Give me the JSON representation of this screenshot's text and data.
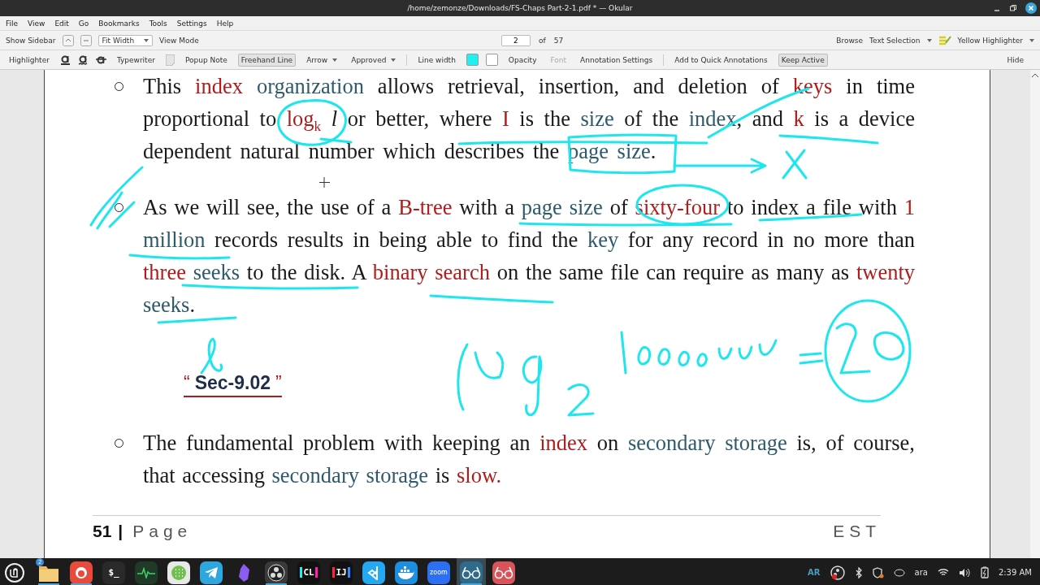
{
  "window": {
    "title": "/home/zemonze/Downloads/FS-Chaps Part-2-1.pdf * — Okular"
  },
  "menu": [
    "File",
    "View",
    "Edit",
    "Go",
    "Bookmarks",
    "Tools",
    "Settings",
    "Help"
  ],
  "toolbar": {
    "show_sidebar": "Show Sidebar",
    "zoom": "Fit Width",
    "view_mode": "View Mode",
    "page": "2",
    "of": "of",
    "total": "57",
    "browse": "Browse",
    "text_selection": "Text Selection",
    "highlighter": "Yellow Highlighter"
  },
  "annotation_bar": [
    {
      "kind": "label",
      "label": "Highlighter"
    },
    {
      "kind": "underline"
    },
    {
      "kind": "squiggle"
    },
    {
      "kind": "strike"
    },
    {
      "kind": "label",
      "label": "Typewriter"
    },
    {
      "kind": "note"
    },
    {
      "kind": "label",
      "label": "Popup Note"
    },
    {
      "kind": "toggle",
      "label": "Freehand Line",
      "selected": true
    },
    {
      "kind": "dropdown",
      "label": "Arrow"
    },
    {
      "kind": "dropdown",
      "label": "Approved"
    },
    {
      "kind": "separator"
    },
    {
      "kind": "label",
      "label": "Line width"
    },
    {
      "kind": "swatch",
      "color": "#22f0f0"
    },
    {
      "kind": "swatch",
      "color": "#ffffff"
    },
    {
      "kind": "label",
      "label": "Opacity"
    },
    {
      "kind": "label",
      "label": "Font",
      "disabled": true
    },
    {
      "kind": "label",
      "label": "Annotation Settings"
    },
    {
      "kind": "separator"
    },
    {
      "kind": "label",
      "label": "Add to Quick Annotations"
    },
    {
      "kind": "toggle",
      "label": "Keep Active",
      "selected": true
    },
    {
      "kind": "spacer"
    },
    {
      "kind": "label",
      "label": "Hide"
    }
  ],
  "document": {
    "paragraphs": [
      {
        "bullet": true,
        "segments": [
          {
            "text": "This ",
            "color": "#1a1a1a"
          },
          {
            "text": "index ",
            "color": "#b01c1c"
          },
          {
            "text": "organization",
            "color": "#2e5a6b"
          },
          {
            "text": " allows retrieval, insertion, and deletion of ",
            "color": "#1a1a1a"
          },
          {
            "text": "keys",
            "color": "#b01c1c"
          },
          {
            "text": " in time proportional to ",
            "color": "#1a1a1a"
          },
          {
            "text": "log$_{k}$",
            "color": "#b01c1c"
          },
          {
            "text": " *l* or better, where ",
            "color": "#1a1a1a"
          },
          {
            "text": "I",
            "color": "#b01c1c"
          },
          {
            "text": " is the ",
            "color": "#1a1a1a"
          },
          {
            "text": "size",
            "color": "#2e5a6b"
          },
          {
            "text": " of the ",
            "color": "#1a1a1a"
          },
          {
            "text": "index",
            "color": "#2e5a6b"
          },
          {
            "text": ", and ",
            "color": "#1a1a1a"
          },
          {
            "text": "k",
            "color": "#b01c1c"
          },
          {
            "text": " is a device dependent natural number which describes the ",
            "color": "#1a1a1a"
          },
          {
            "text": "page size",
            "color": "#2e5a6b"
          },
          {
            "text": ".",
            "color": "#1a1a1a"
          }
        ]
      },
      {
        "bullet": true,
        "segments": [
          {
            "text": "As we will see, the use of a ",
            "color": "#1a1a1a"
          },
          {
            "text": "B-tree",
            "color": "#b01c1c"
          },
          {
            "text": " with a ",
            "color": "#1a1a1a"
          },
          {
            "text": "page size",
            "color": "#2e5a6b"
          },
          {
            "text": " of ",
            "color": "#1a1a1a"
          },
          {
            "text": "sixty-four",
            "color": "#b01c1c"
          },
          {
            "text": " to index a file with ",
            "color": "#1a1a1a"
          },
          {
            "text": "1 ",
            "color": "#b01c1c"
          },
          {
            "text": "million",
            "color": "#2e5a6b"
          },
          {
            "text": " records results in being able to find the ",
            "color": "#1a1a1a"
          },
          {
            "text": "key",
            "color": "#2e5a6b"
          },
          {
            "text": " for any record in no more than ",
            "color": "#1a1a1a"
          },
          {
            "text": "three ",
            "color": "#b01c1c"
          },
          {
            "text": "seeks",
            "color": "#2e5a6b"
          },
          {
            "text": " to the disk. A ",
            "color": "#1a1a1a"
          },
          {
            "text": "binary search",
            "color": "#b01c1c"
          },
          {
            "text": " on the same file can require as many as ",
            "color": "#1a1a1a"
          },
          {
            "text": "twenty ",
            "color": "#b01c1c"
          },
          {
            "text": "seeks",
            "color": "#2e5a6b"
          },
          {
            "text": ".",
            "color": "#1a1a1a"
          }
        ]
      }
    ],
    "heading": [
      {
        "text": "“",
        "color": "#b01c1c"
      },
      {
        "text": "Sec-9.02",
        "color": "#1f2d4a"
      },
      {
        "text": "”",
        "color": "#b01c1c"
      }
    ],
    "paragraphs_after": [
      {
        "bullet": true,
        "segments": [
          {
            "text": "The fundamental problem with keeping an ",
            "color": "#1a1a1a"
          },
          {
            "text": "index",
            "color": "#b01c1c"
          },
          {
            "text": " on ",
            "color": "#1a1a1a"
          },
          {
            "text": "secondary storage",
            "color": "#2e5a6b"
          },
          {
            "text": " is, of course, that accessing ",
            "color": "#1a1a1a"
          },
          {
            "text": "secondary storage",
            "color": "#2e5a6b"
          },
          {
            "text": " is ",
            "color": "#1a1a1a"
          },
          {
            "text": "slow.",
            "color": "#b01c1c"
          }
        ]
      }
    ],
    "footer": {
      "page_number": "51",
      "separator": "|",
      "page_label": "Page",
      "right": "EST"
    }
  },
  "taskbar": {
    "apps": [
      {
        "kind": "folder",
        "badge": "2",
        "running": true,
        "selected": false
      },
      {
        "kind": "firefox",
        "running": true,
        "selected": false
      },
      {
        "kind": "terminal",
        "label": "$_",
        "running": false,
        "selected": false
      },
      {
        "kind": "monitor",
        "running": false,
        "selected": false
      },
      {
        "kind": "grid",
        "running": false,
        "selected": false
      },
      {
        "kind": "telegram",
        "running": false,
        "selected": false
      },
      {
        "kind": "crystal",
        "running": false,
        "selected": false
      },
      {
        "kind": "obs",
        "running": true,
        "selected": false
      },
      {
        "kind": "clion",
        "label": "CL",
        "running": false,
        "selected": false
      },
      {
        "kind": "intellij",
        "label": "IJ",
        "running": false,
        "selected": false
      },
      {
        "kind": "vscode",
        "running": false,
        "selected": false
      },
      {
        "kind": "docker",
        "running": false,
        "selected": false
      },
      {
        "kind": "zoom",
        "label": "zoom",
        "running": false,
        "selected": false
      },
      {
        "kind": "glasses",
        "running": true,
        "selected": true
      },
      {
        "kind": "glasses-alt",
        "running": false,
        "selected": false
      }
    ],
    "tray": {
      "keyboard": "AR",
      "layout": "ara",
      "time": "2:39 AM"
    }
  }
}
